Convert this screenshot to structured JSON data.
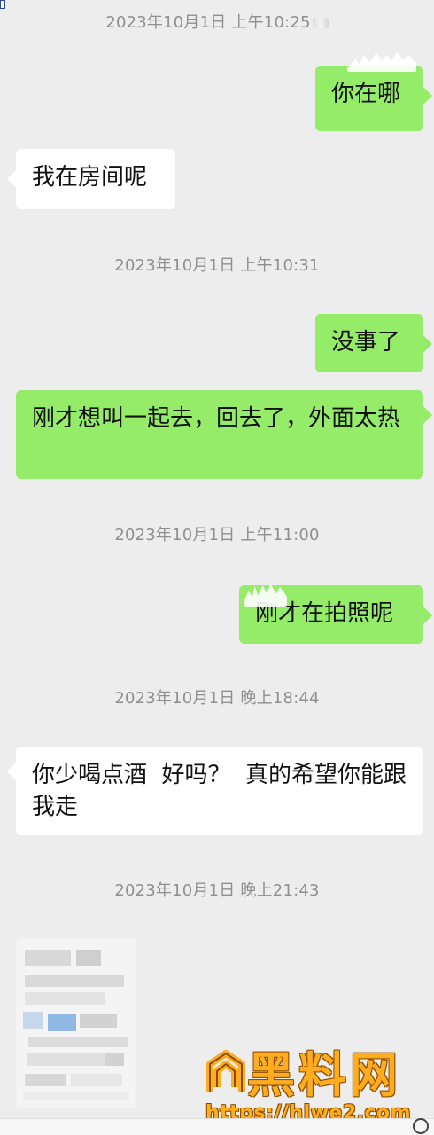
{
  "timestamps": [
    "2023年10月1日 上午10:25",
    "2023年10月1日 上午10:31",
    "2023年10月1日 上午11:00",
    "2023年10月1日 晚上18:44",
    "2023年10月1日 晚上21:43"
  ],
  "messages": [
    "你在哪",
    "我在房间呢",
    "没事了",
    "刚才想叫一起去，回去了，外面太热",
    "刚才在拍照呢",
    "你少喝点酒  好吗？  真的希望你能跟我走"
  ],
  "watermark": {
    "title": "黑料网",
    "url": "https://hlwe2.com",
    "brand_color": "#ffad1f",
    "shadow_color": "#8a4d00"
  },
  "colors": {
    "background": "#ededed",
    "outgoing_bubble": "#95ec69",
    "incoming_bubble": "#ffffff",
    "timestamp": "#8f8f8f",
    "text": "#111111"
  },
  "icons": {
    "status_icon": "circle-icon"
  }
}
